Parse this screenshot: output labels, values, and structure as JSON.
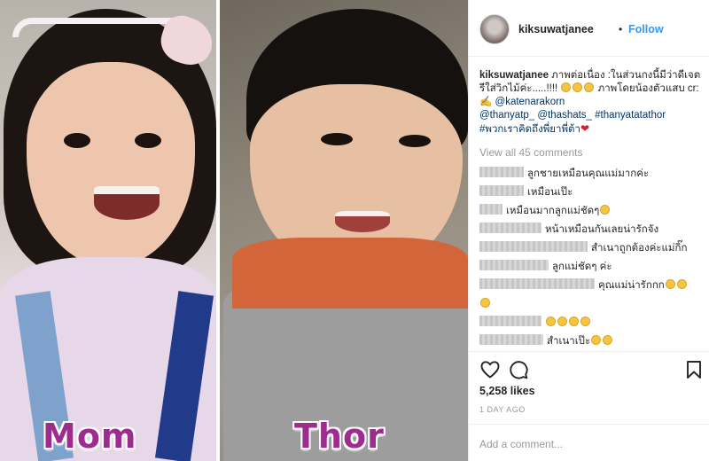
{
  "photo": {
    "caption_left": "Mom",
    "caption_right": "Thor"
  },
  "post": {
    "username": "kiksuwatjanee",
    "separator": "•",
    "follow_label": "Follow",
    "caption_username": "kiksuwatjanee",
    "caption_line1": " ภาพต่อเนื่อง :ในส่วนกงนี้มีว่าดีเจตรีใส่วิกไม้ค่ะ.....!!!! ",
    "caption_line2": " ภาพโดยน้องตัวแสบ cr:✍ ",
    "caption_mention1": "@katenarakorn",
    "caption_mention2": "@thanyatp_",
    "caption_mention3": "@thashats_",
    "caption_hashtag1": "#thanyatatathor",
    "caption_hashtag2": "#พวกเราคิดถึงพี่ยาพี่ต้า",
    "heart": "❤",
    "view_all_comments": "View all 45 comments",
    "comments": [
      {
        "text": "ลูกชายเหมือนคุณแม่มากค่ะ",
        "emoji": 0
      },
      {
        "text": "เหมือนเป๊ะ",
        "emoji": 0
      },
      {
        "text": "เหมือนมากลูกแม่ชัดๆ",
        "emoji": 1
      },
      {
        "text": "หน้าเหมือนกันเลยน่ารักจัง",
        "emoji": 0
      },
      {
        "text": "สำเนาถูกต้องค่ะแม่กิ๊ก",
        "emoji": 0
      },
      {
        "text": "ลูกแม่ชัดๆ ค่ะ",
        "emoji": 0
      },
      {
        "text": "คุณแม่น่ารักกก",
        "emoji": 2
      },
      {
        "text": "",
        "emoji": 1
      },
      {
        "text": "",
        "emoji": 4
      },
      {
        "text": "สำเนาเป๊ะ",
        "emoji": 2
      }
    ],
    "likes": "5,258 likes",
    "date": "1 DAY AGO",
    "add_comment_placeholder": "Add a comment..."
  },
  "icons": {
    "like": "heart-outline-icon",
    "comment": "speech-bubble-icon",
    "save": "bookmark-icon"
  },
  "colors": {
    "follow": "#3897f0",
    "caption_text": "#9c2c8e",
    "link": "#003569",
    "muted": "#999999"
  }
}
